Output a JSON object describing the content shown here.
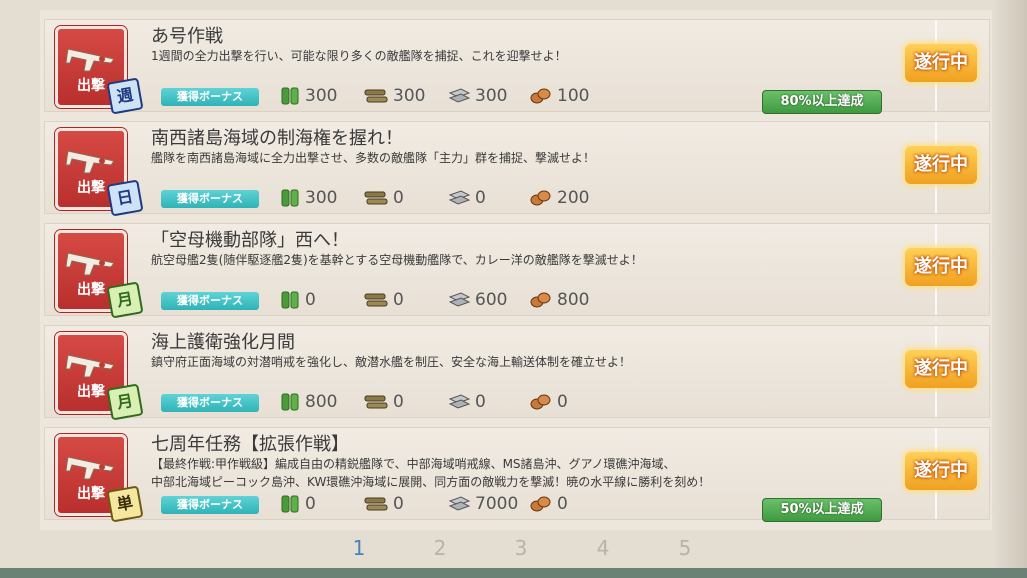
{
  "quests": [
    {
      "category": "出撃",
      "frequency": "週",
      "title": "あ号作戦",
      "desc_lines": [
        "1週間の全力出撃を行い、可能な限り多くの敵艦隊を捕捉、これを迎撃せよ！"
      ],
      "bonus": "獲得ボーナス",
      "fuel": "300",
      "ammo": "300",
      "steel": "300",
      "bauxite": "100",
      "status": "遂行中",
      "progress": "80%以上達成"
    },
    {
      "category": "出撃",
      "frequency": "日",
      "title": "南西諸島海域の制海権を握れ！",
      "desc_lines": [
        "艦隊を南西諸島海域に全力出撃させ、多数の敵艦隊「主力」群を捕捉、撃滅せよ！"
      ],
      "bonus": "獲得ボーナス",
      "fuel": "300",
      "ammo": "0",
      "steel": "0",
      "bauxite": "200",
      "status": "遂行中",
      "progress": ""
    },
    {
      "category": "出撃",
      "frequency": "月",
      "title": "「空母機動部隊」西へ！",
      "desc_lines": [
        "航空母艦2隻(随伴駆逐艦2隻)を基幹とする空母機動艦隊で、カレー洋の敵艦隊を撃滅せよ！"
      ],
      "bonus": "獲得ボーナス",
      "fuel": "0",
      "ammo": "0",
      "steel": "600",
      "bauxite": "800",
      "status": "遂行中",
      "progress": ""
    },
    {
      "category": "出撃",
      "frequency": "月",
      "title": "海上護衛強化月間",
      "desc_lines": [
        "鎮守府正面海域の対潜哨戒を強化し、敵潜水艦を制圧、安全な海上輸送体制を確立せよ！"
      ],
      "bonus": "獲得ボーナス",
      "fuel": "800",
      "ammo": "0",
      "steel": "0",
      "bauxite": "0",
      "status": "遂行中",
      "progress": ""
    },
    {
      "category": "出撃",
      "frequency": "単",
      "title": "七周年任務【拡張作戦】",
      "desc_lines": [
        "【最終作戦:甲作戦級】編成自由の精鋭艦隊で、中部海域哨戒線、MS諸島沖、グアノ環礁沖海域、",
        "中部北海域ピーコック島沖、KW環礁沖海域に展開、同方面の敵戦力を撃滅！暁の水平線に勝利を刻め！"
      ],
      "bonus": "獲得ボーナス",
      "fuel": "0",
      "ammo": "0",
      "steel": "7000",
      "bauxite": "0",
      "status": "遂行中",
      "progress": "50%以上達成"
    }
  ],
  "pagination": {
    "pages": [
      "1",
      "2",
      "3",
      "4",
      "5"
    ],
    "active": "1"
  },
  "colors": {
    "status_orange": "#f0a020",
    "bonus_teal": "#2fb3b6",
    "progress_green": "#3f9a3f",
    "category_red": "#b82f2d"
  },
  "icons": {
    "fuel": "fuel-icon",
    "ammo": "ammo-icon",
    "steel": "steel-icon",
    "bauxite": "bauxite-icon",
    "category": "plane-icon"
  }
}
